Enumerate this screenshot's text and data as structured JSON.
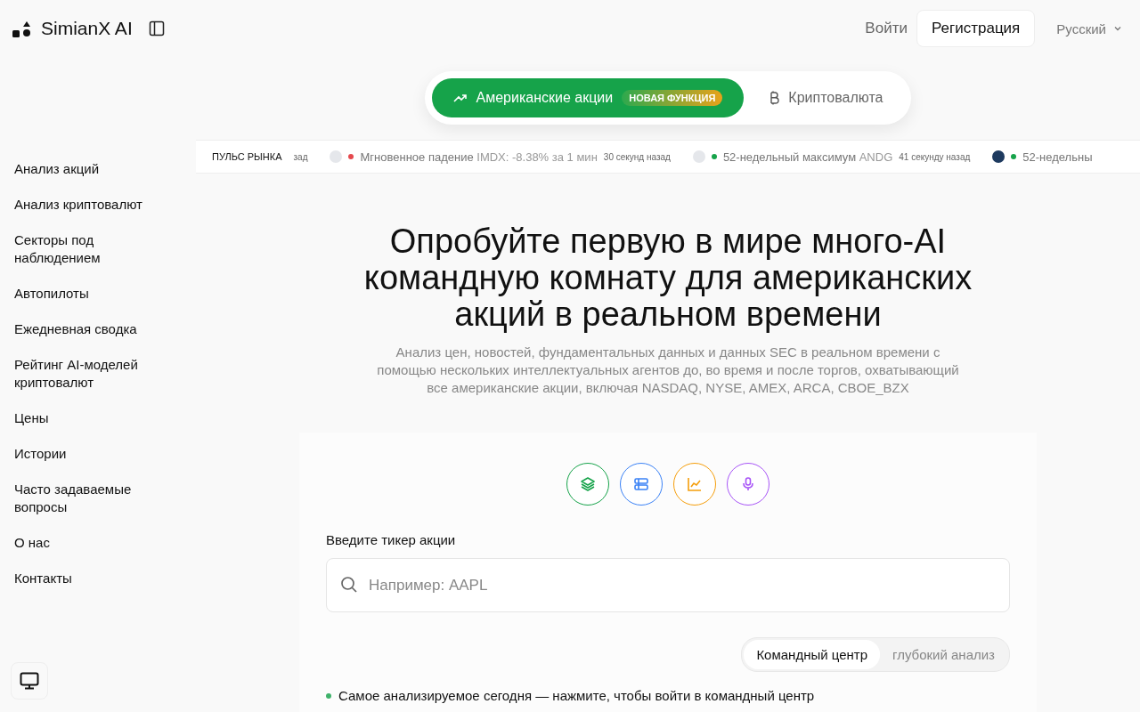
{
  "header": {
    "brand": "SimianX AI",
    "login": "Войти",
    "register": "Регистрация",
    "language": "Русский"
  },
  "mode_tabs": [
    {
      "label": "Американские акции",
      "badge": "НОВАЯ ФУНКЦИЯ",
      "selected": true,
      "kind": "stocks"
    },
    {
      "label": "Криптовалюта",
      "selected": false,
      "kind": "crypto"
    }
  ],
  "ticker": {
    "label": "ПУЛЬС РЫНКА",
    "fragment": "зад",
    "items": [
      {
        "event": "Мгновенное падение",
        "detail": "IMDX: -8.38% за 1 мин",
        "time": "30 секунд назад",
        "color": "#e5484d"
      },
      {
        "event": "52-недельный максимум",
        "detail": "ANDG",
        "time": "41 секунду назад",
        "color": "#16a34a"
      },
      {
        "event": "52-недельны",
        "color": "#16a34a"
      }
    ]
  },
  "sidebar": {
    "items": [
      "Анализ акций",
      "Анализ криптовалют",
      "Секторы под наблюдением",
      "Автопилоты",
      "Ежедневная сводка",
      "Рейтинг AI-моделей криптовалют",
      "Цены",
      "Истории",
      "Часто задаваемые вопросы",
      "О нас",
      "Контакты"
    ]
  },
  "hero": {
    "title": "Опробуйте первую в мире много-AI командную комнату для американских акций в реальном времени",
    "subtitle": "Анализ цен, новостей, фундаментальных данных и данных SEC в реальном времени с помощью нескольких интеллектуальных агентов до, во время и после торгов, охватывающий все американские акции, включая NASDAQ, NYSE, AMEX, ARCA, CBOE_BZX"
  },
  "feature_icons": [
    {
      "kind": "layers",
      "color": "#16a34a"
    },
    {
      "kind": "panels",
      "color": "#3b82f6"
    },
    {
      "kind": "chart",
      "color": "#f59e0b"
    },
    {
      "kind": "mic",
      "color": "#a855f7"
    }
  ],
  "ticker_input": {
    "label": "Введите тикер акции",
    "placeholder": "Например: AAPL"
  },
  "analysis_modes": [
    {
      "label": "Командный центр",
      "selected": true
    },
    {
      "label": "глубокий анализ",
      "selected": false
    }
  ],
  "hint": "Самое анализируемое сегодня — нажмите, чтобы войти в командный центр"
}
